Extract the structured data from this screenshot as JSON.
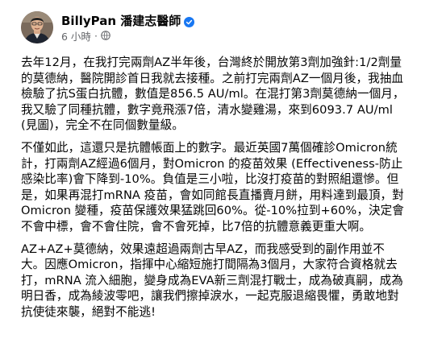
{
  "post": {
    "author_name": "BillyPan 潘建志醫師",
    "timestamp": "6 小時",
    "separator": "·",
    "verified_icon": "verified-badge",
    "audience_icon": "public-globe",
    "colors": {
      "verified": "#1877f2",
      "meta_text": "#65676b",
      "body_text": "#050505"
    },
    "paragraphs": [
      "去年12月，在我打完兩劑AZ半年後，台灣終於開放第3劑加強針:1/2劑量的莫德納，醫院開診首日我就去接種。之前打完兩劑AZ一個月後，我抽血檢驗了抗S蛋白抗體，數值是856.5 AU/ml。在混打第3劑莫德納一個月，我又驗了同種抗體，數字竟飛漲7倍，清水變雞湯，來到6093.7 AU/ml(見圖)，完全不在同個數量級。",
      "不僅如此，這還只是抗體帳面上的數字。最近英國7萬個確診Omicron統計，打兩劑AZ經過6個月，對Omicron 的疫苗效果 (Effectiveness-防止感染比率)會下降到-10%。負值是三小啦，比沒打疫苗的對照組還慘。但是，如果再混打mRNA 疫苗，會如同館長直播賣月餅，用料達到最頂，對Omicron 變種，疫苗保護效果猛跳回60%。從-10%拉到+60%，決定會不會中標，會不會住院，會不會死掉，比7倍的抗體意義更重大啊。",
      "AZ+AZ+莫德納，效果遠超過兩劑古早AZ，而我感受到的副作用並不大。因應Omicron，指揮中心縮短施打間隔為3個月，大家符合資格就去打，mRNA 流入細胞，變身成為EVA新三劑混打戰士，成為破真嗣，成為明日香，成為綾波零吧，讓我們擦掉淚水，一起克服退縮畏懼，勇敢地對抗使徒來襲，絕對不能逃!"
    ]
  }
}
